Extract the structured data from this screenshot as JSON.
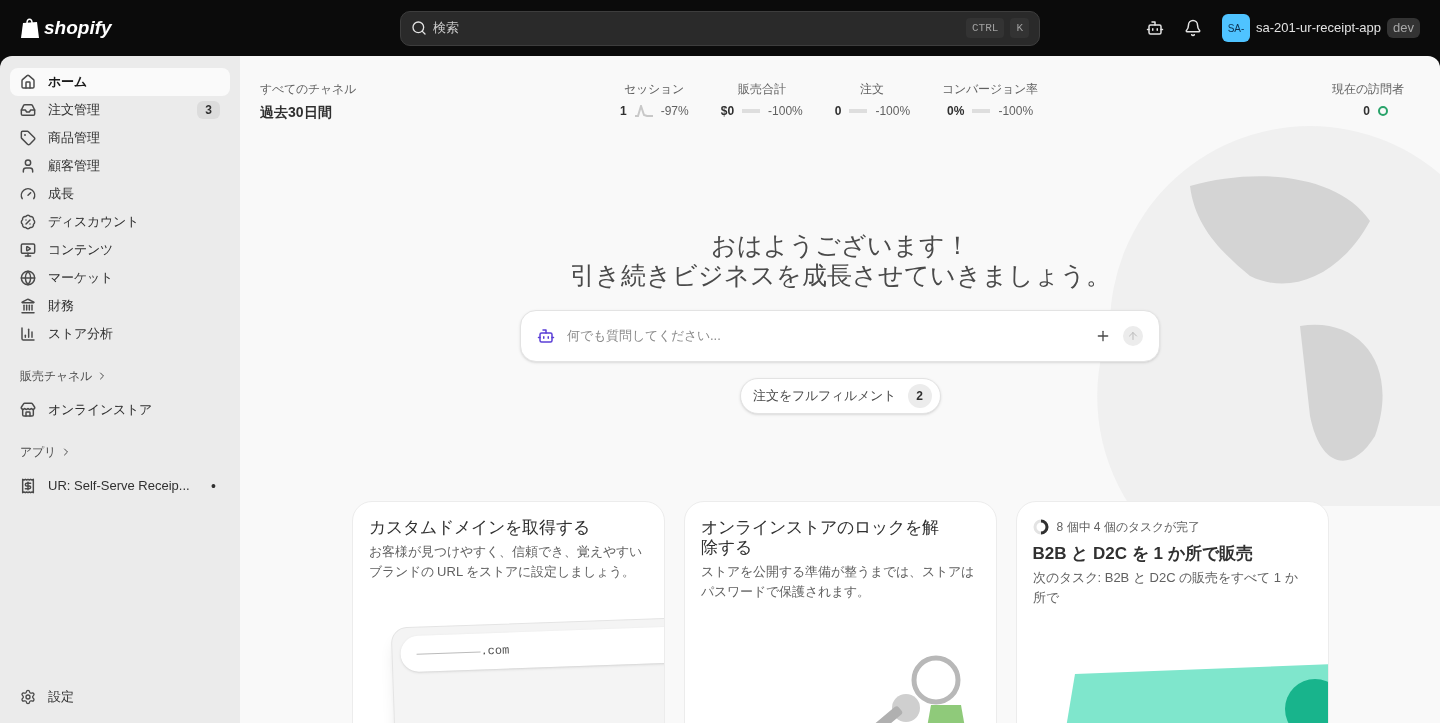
{
  "topbar": {
    "logo": "shopify",
    "search": {
      "placeholder": "検索"
    },
    "shortcut": [
      "CTRL",
      "K"
    ],
    "store": {
      "initials": "SA-",
      "name": "sa-201-ur-receipt-app",
      "badge": "dev"
    }
  },
  "sidebar": {
    "items": [
      {
        "label": "ホーム",
        "selected": true
      },
      {
        "label": "注文管理",
        "selected": false,
        "badge": "3"
      },
      {
        "label": "商品管理",
        "selected": false
      },
      {
        "label": "顧客管理",
        "selected": false
      },
      {
        "label": "成長",
        "selected": false
      },
      {
        "label": "ディスカウント",
        "selected": false
      },
      {
        "label": "コンテンツ",
        "selected": false
      },
      {
        "label": "マーケット",
        "selected": false
      },
      {
        "label": "財務",
        "selected": false
      },
      {
        "label": "ストア分析",
        "selected": false
      }
    ],
    "sections": [
      {
        "title": "販売チャネル",
        "items": [
          {
            "label": "オンラインストア",
            "selected": false
          }
        ]
      },
      {
        "title": "アプリ",
        "items": [
          {
            "label": "UR: Self-Serve Receip...",
            "selected": false,
            "dot": "•"
          }
        ]
      }
    ],
    "settings": "設定"
  },
  "stats": {
    "channel": "すべてのチャネル",
    "period": "過去30日間",
    "metrics": [
      {
        "label": "セッション",
        "value": "1",
        "change": "-97%"
      },
      {
        "label": "販売合計",
        "value": "$0",
        "change": "-100%"
      },
      {
        "label": "注文",
        "value": "0",
        "change": "-100%"
      },
      {
        "label": "コンバージョン率",
        "value": "0%",
        "change": "-100%"
      }
    ],
    "visitors": {
      "label": "現在の訪問者",
      "value": "0"
    }
  },
  "greeting": [
    "おはようございます！",
    "引き続きビジネスを成長させていきましょう。"
  ],
  "ask": {
    "placeholder": "何でも質問してください..."
  },
  "fulfill": {
    "label": "注文をフルフィルメント",
    "count": "2"
  },
  "cards": [
    {
      "kind": "domain",
      "title": "カスタムドメインを取得する",
      "body": "お客様が見つけやすく、信頼でき、覚えやすいブランドの URL をストアに設定しましょう。",
      "domain": ".com"
    },
    {
      "kind": "lock",
      "title": "オンラインストアのロックを解除する",
      "body": "ストアを公開する準備が整うまでは、ストアはパスワードで保護されます。"
    },
    {
      "kind": "tasks",
      "progress_text": "8 個中 4 個のタスクが完了",
      "level": 0.5,
      "title": "B2B と D2C を 1 か所で販売",
      "body": "次のタスク: B2B と D2C の販売をすべて 1 か所で"
    }
  ]
}
